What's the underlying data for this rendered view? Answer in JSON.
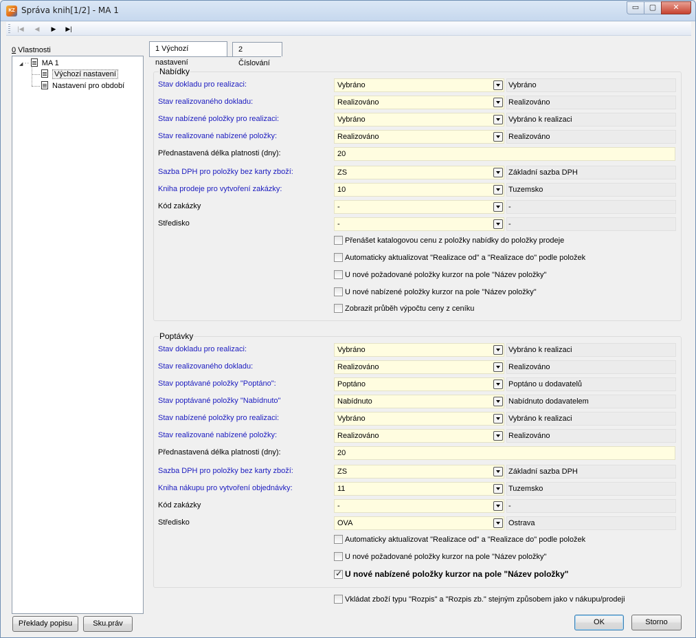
{
  "window": {
    "icon_text": "KZ",
    "title": "Správa knih[1/2] - MA 1",
    "min_glyph": "▭",
    "max_glyph": "▢",
    "close_glyph": "✕"
  },
  "nav": {
    "first": "|◀",
    "prev": "◀",
    "next": "▶",
    "last": "▶|"
  },
  "left_panel": {
    "label_key": "0",
    "label_rest": " Vlastnosti",
    "tree": {
      "expander": "◢",
      "root": "MA 1",
      "children": [
        "Výchozí nastavení",
        "Nastavení pro období"
      ]
    },
    "btn_translations": "Překlady popisu",
    "btn_rights": "Sku.práv"
  },
  "tabs": [
    "1 Výchozí nastavení",
    "2 Číslování"
  ],
  "nabidky": {
    "title": "Nabídky",
    "rows": [
      {
        "label": "Stav dokladu pro realizaci:",
        "value": "Vybráno",
        "extra": "Vybráno"
      },
      {
        "label": "Stav realizovaného dokladu:",
        "value": "Realizováno",
        "extra": "Realizováno"
      },
      {
        "label": "Stav nabízené položky pro realizaci:",
        "value": "Vybráno",
        "extra": "Vybráno k realizaci"
      },
      {
        "label": "Stav realizované nabízené položky:",
        "value": "Realizováno",
        "extra": "Realizováno"
      },
      {
        "label": "Přednastavená délka platnosti (dny):",
        "value": "20"
      },
      {
        "label": "Sazba DPH pro položky bez karty zboží:",
        "value": "ZS",
        "extra": "Základní sazba DPH"
      },
      {
        "label": "Kniha prodeje pro vytvoření zakázky:",
        "value": "10",
        "extra": "Tuzemsko"
      },
      {
        "label": "Kód zakázky",
        "value": "-",
        "extra": "-"
      },
      {
        "label": "Středisko",
        "value": "-",
        "extra": "-"
      }
    ],
    "checks": [
      {
        "label": "Přenášet katalogovou cenu z položky nabídky do položky prodeje",
        "checked": false
      },
      {
        "label": "Automaticky aktualizovat \"Realizace od\" a \"Realizace do\" podle položek",
        "checked": false
      },
      {
        "label": "U nové požadované položky kurzor na pole \"Název položky\"",
        "checked": false
      },
      {
        "label": "U nové nabízené položky kurzor na pole \"Název položky\"",
        "checked": false
      },
      {
        "label": "Zobrazit průběh výpočtu ceny z ceníku",
        "checked": false
      }
    ]
  },
  "poptavky": {
    "title": "Poptávky",
    "rows": [
      {
        "label": "Stav dokladu pro realizaci:",
        "value": "Vybráno",
        "extra": "Vybráno k realizaci"
      },
      {
        "label": "Stav realizovaného dokladu:",
        "value": "Realizováno",
        "extra": "Realizováno"
      },
      {
        "label": "Stav poptávané položky \"Poptáno\":",
        "value": "Poptáno",
        "extra": "Poptáno u dodavatelů"
      },
      {
        "label": "Stav poptávané položky \"Nabídnuto\"",
        "value": "Nabídnuto",
        "extra": "Nabídnuto dodavatelem"
      },
      {
        "label": "Stav nabízené položky pro realizaci:",
        "value": "Vybráno",
        "extra": "Vybráno k realizaci"
      },
      {
        "label": "Stav realizované nabízené položky:",
        "value": "Realizováno",
        "extra": "Realizováno"
      },
      {
        "label": "Přednastavená délka platnosti (dny):",
        "value": "20"
      },
      {
        "label": "Sazba DPH pro položky bez karty zboží:",
        "value": "ZS",
        "extra": "Základní sazba DPH"
      },
      {
        "label": "Kniha nákupu pro vytvoření objednávky:",
        "value": "11",
        "extra": "Tuzemsko"
      },
      {
        "label": "Kód zakázky",
        "value": "-",
        "extra": "-"
      },
      {
        "label": "Středisko",
        "value": "OVA",
        "extra": "Ostrava"
      }
    ],
    "checks": [
      {
        "label": "Automaticky aktualizovat \"Realizace od\" a \"Realizace do\" podle položek",
        "checked": false
      },
      {
        "label": "U nové požadované položky kurzor na pole \"Název položky\"",
        "checked": false
      },
      {
        "label": "U nové nabízené položky kurzor na pole \"Název položky\"",
        "checked": true
      }
    ]
  },
  "bottom_check": {
    "label": "Vkládat zboží typu \"Rozpis\" a \"Rozpis zb.\" stejným způsobem jako v nákupu/prodeji",
    "checked": false
  },
  "footer": {
    "ok": "OK",
    "cancel": "Storno"
  }
}
